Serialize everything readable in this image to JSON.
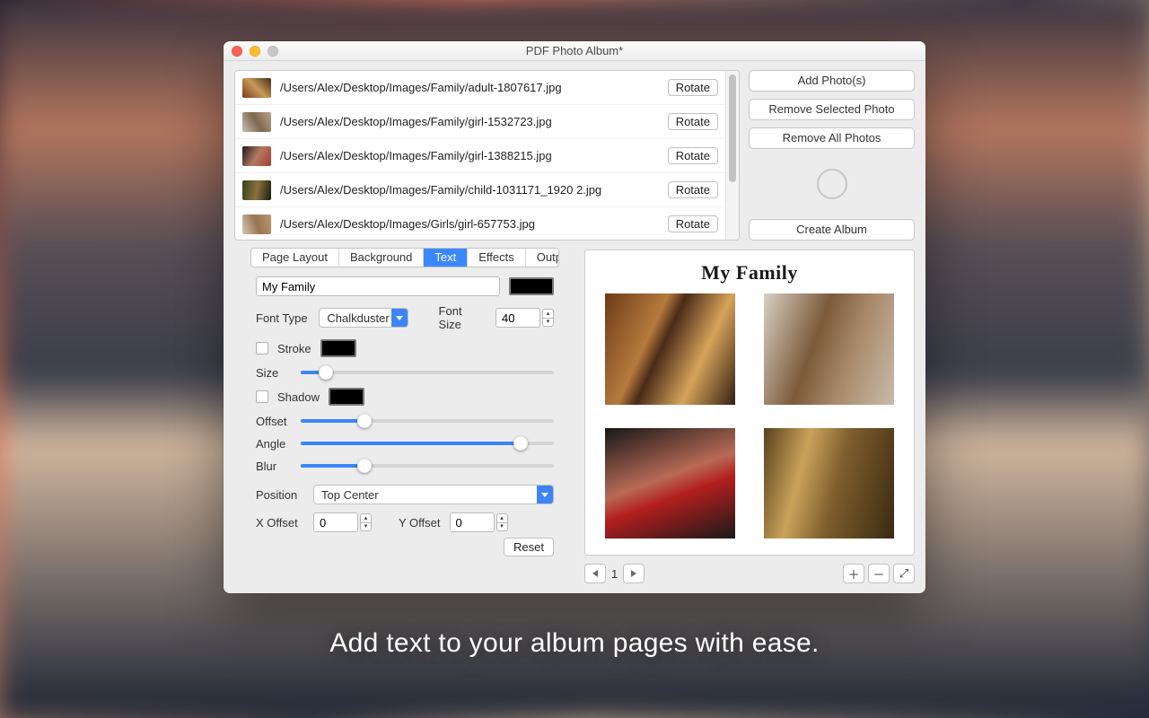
{
  "window": {
    "title": "PDF Photo Album*"
  },
  "photolist": [
    {
      "path": "/Users/Alex/Desktop/Images/Family/adult-1807617.jpg",
      "rotate": "Rotate"
    },
    {
      "path": "/Users/Alex/Desktop/Images/Family/girl-1532723.jpg",
      "rotate": "Rotate"
    },
    {
      "path": "/Users/Alex/Desktop/Images/Family/girl-1388215.jpg",
      "rotate": "Rotate"
    },
    {
      "path": "/Users/Alex/Desktop/Images/Family/child-1031171_1920 2.jpg",
      "rotate": "Rotate"
    },
    {
      "path": "/Users/Alex/Desktop/Images/Girls/girl-657753.jpg",
      "rotate": "Rotate"
    }
  ],
  "rightcol": {
    "add": "Add Photo(s)",
    "remove_sel": "Remove Selected Photo",
    "remove_all": "Remove All Photos",
    "create": "Create Album"
  },
  "tabs": {
    "page_layout": "Page Layout",
    "background": "Background",
    "text": "Text",
    "effects": "Effects",
    "output": "Output"
  },
  "text_settings": {
    "title_value": "My Family",
    "font_type_label": "Font Type",
    "font_type_value": "Chalkduster",
    "font_size_label": "Font Size",
    "font_size_value": "40",
    "stroke_label": "Stroke",
    "size_label": "Size",
    "shadow_label": "Shadow",
    "offset_label": "Offset",
    "angle_label": "Angle",
    "blur_label": "Blur",
    "position_label": "Position",
    "position_value": "Top Center",
    "xoff_label": "X Offset",
    "xoff_value": "0",
    "yoff_label": "Y Offset",
    "yoff_value": "0",
    "reset": "Reset"
  },
  "preview": {
    "title": "My Family",
    "page": "1"
  },
  "caption": "Add text to your album pages with ease."
}
